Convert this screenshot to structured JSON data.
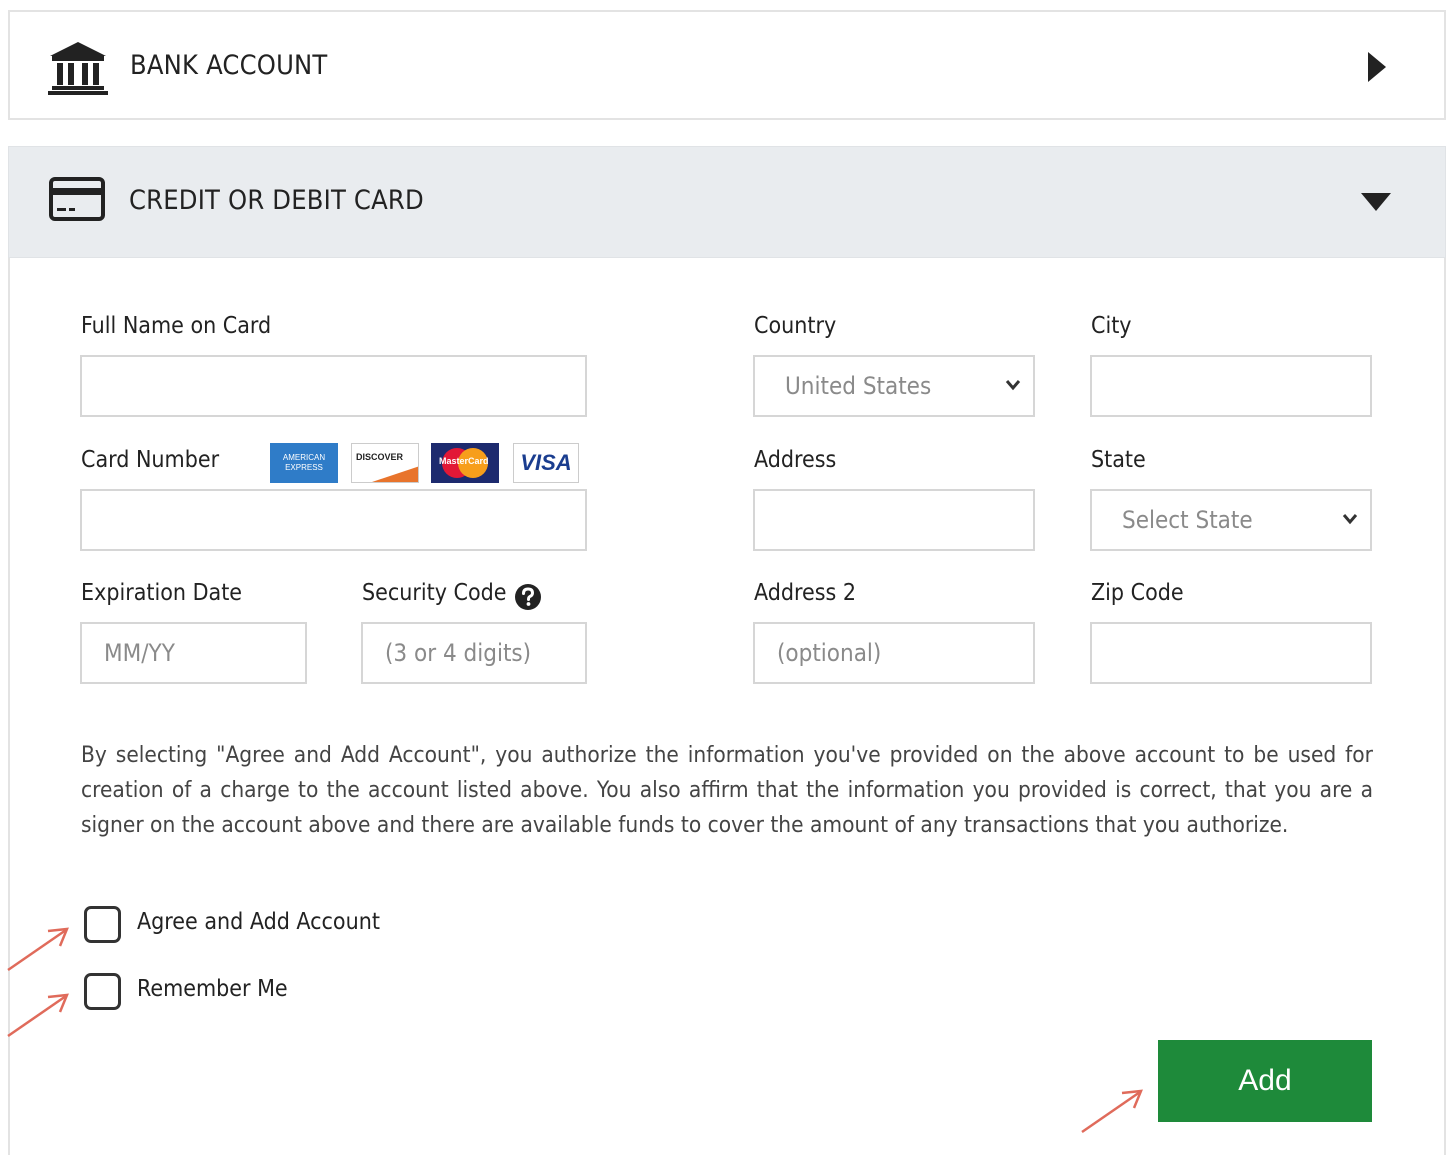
{
  "bank_account": {
    "title": "BANK ACCOUNT",
    "icon": "bank-icon",
    "expanded": false
  },
  "card_section": {
    "title": "CREDIT OR DEBIT CARD",
    "icon": "credit-card-icon",
    "expanded": true
  },
  "form": {
    "full_name": {
      "label": "Full Name on Card",
      "value": ""
    },
    "card_number": {
      "label": "Card Number",
      "value": "",
      "logos": [
        "AMERICAN EXPRESS",
        "DISCOVER",
        "MasterCard",
        "VISA"
      ]
    },
    "expiration": {
      "label": "Expiration Date",
      "placeholder": "MM/YY"
    },
    "security_code": {
      "label": "Security Code",
      "placeholder": "(3 or 4 digits)"
    },
    "country": {
      "label": "Country",
      "selected": "United States"
    },
    "city": {
      "label": "City",
      "value": ""
    },
    "address": {
      "label": "Address",
      "value": ""
    },
    "state": {
      "label": "State",
      "selected": "Select State"
    },
    "address2": {
      "label": "Address 2",
      "placeholder": "(optional)"
    },
    "zip": {
      "label": "Zip Code",
      "value": ""
    }
  },
  "legal_text": "By selecting \"Agree and Add Account\", you authorize the information you've provided on the above account to be used for creation of a charge to the account listed above. You also affirm that the information you provided is correct, that you are a signer on the account above and there are available funds to cover the amount of any transactions that you authorize.",
  "checkboxes": {
    "agree": {
      "label": "Agree and Add Account",
      "checked": false
    },
    "remember": {
      "label": "Remember Me",
      "checked": false
    }
  },
  "add_button": {
    "label": "Add"
  },
  "colors": {
    "accent_green": "#1e8a3a",
    "annotation_arrow": "#e06b5b",
    "header_bg": "#e9ecef"
  }
}
